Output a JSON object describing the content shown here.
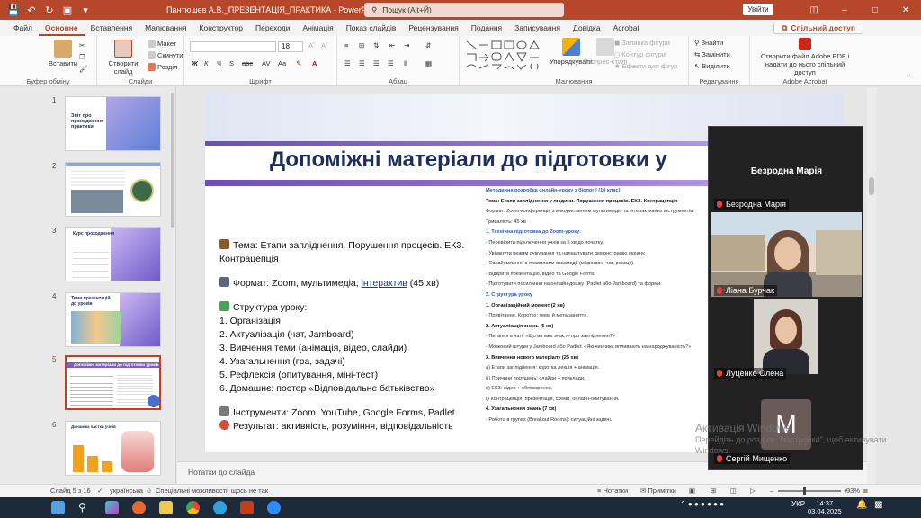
{
  "titlebar": {
    "doc_title": "Пантюшев А.В._ПРЕЗЕНТАЦІЯ_ПРАКТИКА  -  PowerPoint",
    "search_placeholder": "Пошук (Alt+Й)",
    "signin": "Увійти"
  },
  "tabs": [
    "Файл",
    "Основне",
    "Вставлення",
    "Малювання",
    "Конструктор",
    "Переходи",
    "Анімація",
    "Показ слайдів",
    "Рецензування",
    "Подання",
    "Записування",
    "Довідка",
    "Acrobat"
  ],
  "active_tab": "Основне",
  "share_label": "Спільний доступ",
  "ribbon": {
    "clipboard": {
      "paste": "Вставити",
      "label": "Буфер обміну"
    },
    "slides": {
      "new_slide": "Створити слайд",
      "layout": "Макет",
      "reset": "Скинути",
      "section": "Розділ",
      "label": "Слайди"
    },
    "font": {
      "size": "18",
      "label": "Шрифт"
    },
    "paragraph": {
      "label": "Абзац"
    },
    "drawing": {
      "arrange": "Упорядкувати",
      "quick_styles": "Експрес-стилі",
      "fill": "Заливка фігури",
      "outline": "Контур фігури",
      "effects": "Ефекти для фігур",
      "label": "Малювання"
    },
    "editing": {
      "find": "Знайти",
      "replace": "Замінити",
      "select": "Виділити",
      "label": "Редагування"
    },
    "acrobat": {
      "create": "Створити файл Adobe PDF і надати до нього спільний доступ",
      "label": "Adobe Acrobat"
    }
  },
  "thumbnails": [
    {
      "num": "1",
      "text": "Звіт про проходження практики"
    },
    {
      "num": "2",
      "text": ""
    },
    {
      "num": "3",
      "text": "Курс проходження"
    },
    {
      "num": "4",
      "text": "Теми презентацій до уроків"
    },
    {
      "num": "5",
      "text": "Допоміжні матеріали до підготовки уроків"
    },
    {
      "num": "6",
      "text": "Динаміка частки учнів"
    }
  ],
  "slide": {
    "title": "Допоміжні матеріали до підготовки у",
    "topic": "Тема: Етапи запліднення. Порушення процесів. ЕКЗ. Контрацепція",
    "format_prefix": "Формат: Zoom, мультимедіа, ",
    "format_link": "інтерактив",
    "format_suffix": " (45 хв)",
    "structure_title": "Структура уроку:",
    "steps": [
      "1. Організація",
      "2. Актуалізація (чат, Jamboard)",
      "3. Вивчення теми (анімація, відео, слайди)",
      "4. Узагальнення (гра, задачі)",
      "5. Рефлексія (опитування, міні-тест)",
      "6. Домашнє: постер «Відповідальне батьківство»"
    ],
    "tools": "Інструменти: Zoom, YouTube, Google Forms, Padlet",
    "result": "Результат: активність, розуміння, відповідальність",
    "doc_lines": [
      {
        "t": "Методична розробка онлайн-уроку з біології (10 клас)",
        "c": "blue"
      },
      {
        "t": "Тема: Етапи запліднення у людини. Порушення процесів. ЕКЗ. Контрацепція",
        "c": "h"
      },
      {
        "t": "Формат: Zoom-конференція з використанням мультимедіа та інтерактивних інструментів",
        "c": ""
      },
      {
        "t": "Тривалість: 45 хв",
        "c": ""
      },
      {
        "t": "1. Технічна підготовка до Zoom-уроку:",
        "c": "blue"
      },
      {
        "t": "- Перевірити підключення учнів за 5 хв до початку.",
        "c": ""
      },
      {
        "t": "- Увімкнути режим очікування та налаштувати демонстрацію екрану.",
        "c": ""
      },
      {
        "t": "- Ознайомлення з правилами взаємодії (мікрофон, чат, реакції).",
        "c": ""
      },
      {
        "t": "- Відкрити презентацію, відео та Google Forms.",
        "c": ""
      },
      {
        "t": "- Підготувати посилання на онлайн-дошку (Padlet або Jamboard) та форми.",
        "c": ""
      },
      {
        "t": "2. Структура уроку",
        "c": "blue"
      },
      {
        "t": "1. Організаційний момент (2 хв)",
        "c": "h"
      },
      {
        "t": "- Привітання. Коротко: тема й мета заняття.",
        "c": ""
      },
      {
        "t": "2. Актуалізація знань (5 хв)",
        "c": "h"
      },
      {
        "t": "- Питання в чаті: «Що ви вже знаєте про запліднення?»",
        "c": ""
      },
      {
        "t": "- Мозковий штурм у Jamboard або Padlet: «Які чинники впливають на народжуваність?»",
        "c": ""
      },
      {
        "t": "3. Вивчення нового матеріалу (25 хв)",
        "c": "h"
      },
      {
        "t": "а) Етапи запліднення: коротка лекція + анімація.",
        "c": ""
      },
      {
        "t": "б) Причини порушень: слайди + приклади.",
        "c": ""
      },
      {
        "t": "в) ЕКЗ: відео + обговорення.",
        "c": ""
      },
      {
        "t": "г) Контрацепція: презентація, схеми, онлайн-опитування.",
        "c": ""
      },
      {
        "t": "4. Узагальнення знань (7 хв)",
        "c": "h"
      },
      {
        "t": "- Робота в групах (Breakout Rooms): ситуаційні задачі.",
        "c": ""
      }
    ]
  },
  "notes_placeholder": "Нотатки до слайда",
  "video": {
    "speaker": "Безродна Марія",
    "participants": [
      "Безродна Марія",
      "Ліана Бурчак",
      "Луценко Олена",
      "Сергій Мищенко"
    ],
    "avatar_letter": "M"
  },
  "activation": {
    "title": "Активація Windows",
    "text": "Перейдіть до розділу \"Настройки\", щоб активувати Windows."
  },
  "status": {
    "slide": "Слайд 5 з 16",
    "lang": "українська",
    "accessibility": "Спеціальні можливості: щось не так",
    "notes": "Нотатки",
    "comments": "Примітки",
    "zoom": "93%"
  },
  "taskbar": {
    "lang": "УКР",
    "time": "14:37",
    "date": "03.04.2025"
  },
  "colors": {
    "accent": "#b7472a",
    "title_text": "#1f2d5a",
    "link": "#1a3d8f"
  }
}
